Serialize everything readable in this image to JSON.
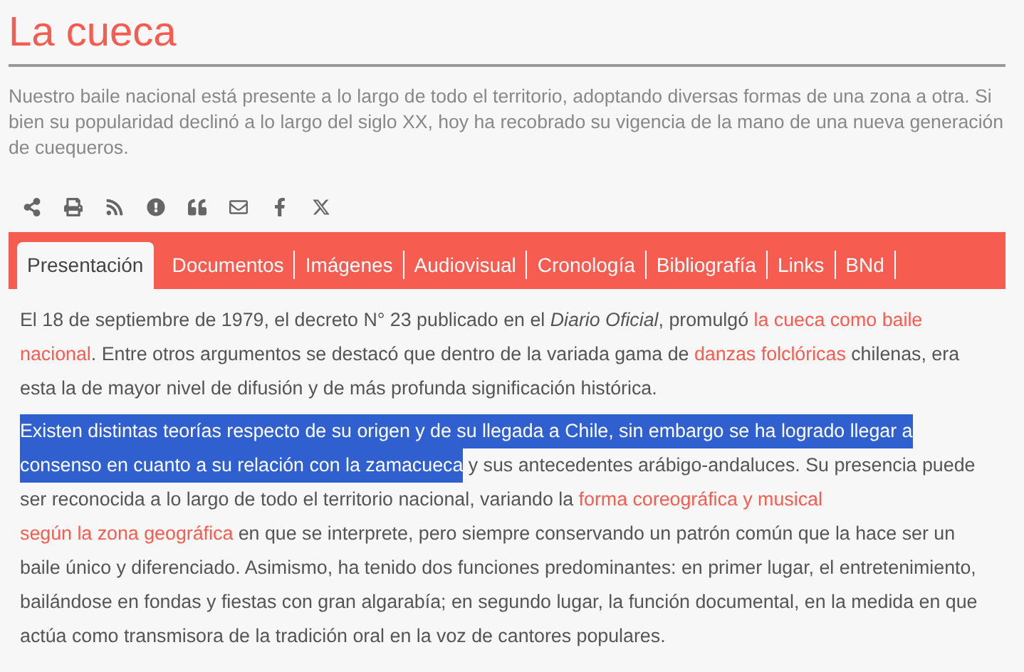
{
  "title": "La cueca",
  "intro": "Nuestro baile nacional está presente a lo largo de todo el territorio, adoptando diversas formas de una zona a otra. Si bien su popularidad declinó a lo largo del siglo XX, hoy ha recobrado su vigencia de la mano de una nueva generación de cuequeros.",
  "tabs": [
    {
      "label": "Presentación",
      "selected": true
    },
    {
      "label": "Documentos",
      "selected": false
    },
    {
      "label": "Imágenes",
      "selected": false
    },
    {
      "label": "Audiovisual",
      "selected": false
    },
    {
      "label": "Cronología",
      "selected": false
    },
    {
      "label": "Bibliografía",
      "selected": false
    },
    {
      "label": "Links",
      "selected": false
    },
    {
      "label": "BNd",
      "selected": false
    }
  ],
  "paragraphs": [
    [
      {
        "kind": "plain",
        "text": "El 18 de septiembre de 1979, el decreto N° 23 publicado en el "
      },
      {
        "kind": "italic",
        "text": "Diario Oficial"
      },
      {
        "kind": "plain",
        "text": ", promulgó "
      },
      {
        "kind": "link",
        "text": "la cueca como baile"
      },
      {
        "kind": "link",
        "text": "nacional"
      },
      {
        "kind": "plain",
        "text": ". Entre otros argumentos se destacó que dentro de la variada gama de "
      },
      {
        "kind": "link",
        "text": "danzas folclóricas"
      },
      {
        "kind": "plain",
        "text": " chilenas, era esta la de mayor nivel de difusión y de más profunda significación histórica."
      }
    ],
    [
      {
        "kind": "selected",
        "text": "Existen distintas teorías respecto de su origen y de su llegada a Chile, sin embargo se ha logrado llegar a"
      },
      {
        "kind": "selected",
        "text": "consenso en cuanto a su relación con la zamacueca"
      },
      {
        "kind": "plain",
        "text": " y sus antecedentes arábigo-andaluces. Su presencia puede ser reconocida a lo largo de todo el territorio nacional, variando la "
      },
      {
        "kind": "link",
        "text": "forma coreográfica y musical"
      },
      {
        "kind": "link",
        "text": "según la zona geográfica"
      },
      {
        "kind": "plain",
        "text": " en que se interprete, pero siempre conservando un patrón común que la hace ser un baile único y diferenciado. Asimismo, ha tenido dos funciones predominantes: en primer lugar, el entretenimiento, bailándose en fondas y fiestas con gran algarabía; en segundo lugar, la función documental, en la medida en que actúa como transmisora de la tradición oral en la voz de cantores populares."
      }
    ]
  ]
}
